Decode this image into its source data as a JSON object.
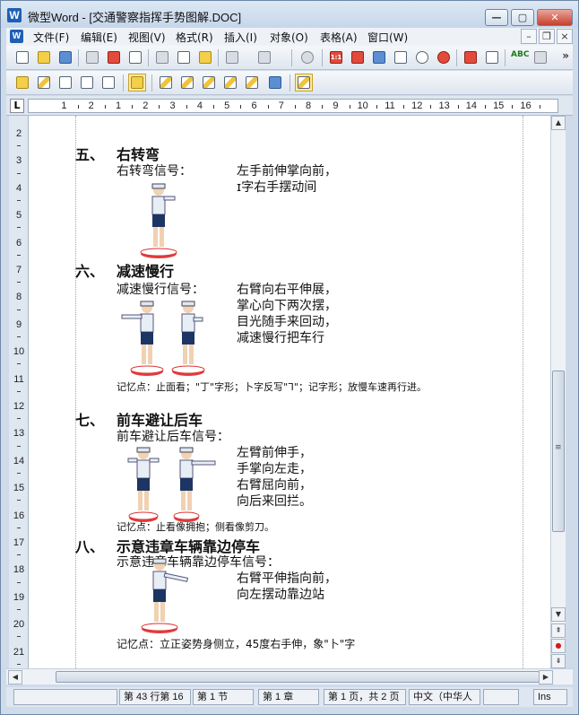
{
  "window": {
    "app_name": "微型Word",
    "title": "微型Word - [交通警察指挥手势图解.DOC]",
    "btn_minimize": "—",
    "btn_maximize": "▢",
    "btn_close": "✕",
    "doc_minimize": "–",
    "doc_restore": "❐",
    "doc_close": "×"
  },
  "menu": {
    "items": [
      {
        "label": "文件(F)"
      },
      {
        "label": "编辑(E)"
      },
      {
        "label": "视图(V)"
      },
      {
        "label": "格式(R)"
      },
      {
        "label": "插入(I)"
      },
      {
        "label": "对象(O)"
      },
      {
        "label": "表格(A)"
      },
      {
        "label": "窗口(W)"
      }
    ]
  },
  "toolbar": {
    "overflow": "»",
    "spell_label": "ABC",
    "table_label": "1:1"
  },
  "ruler": {
    "corner": "L",
    "h_numbers": [
      "1",
      "2",
      "1",
      "2",
      "3",
      "4",
      "5",
      "6",
      "7",
      "8",
      "9",
      "10",
      "11",
      "12",
      "13",
      "14",
      "15",
      "16"
    ],
    "v_numbers": [
      "2",
      "3",
      "4",
      "5",
      "6",
      "7",
      "8",
      "9",
      "10",
      "11",
      "12",
      "13",
      "14",
      "15",
      "16",
      "17",
      "18",
      "19",
      "20",
      "21"
    ]
  },
  "document": {
    "s5": {
      "heading_num": "五、",
      "heading": "右转弯",
      "label": "右转弯信号：",
      "lines": [
        "左手前伸掌向前，",
        "ɪ字右手摆动间"
      ]
    },
    "s6": {
      "heading_num": "六、",
      "heading": "减速慢行",
      "label": "减速慢行信号：",
      "lines": [
        "右臂向右平伸展，",
        "掌心向下两次摆，",
        "目光随手来回动，",
        "减速慢行把车行"
      ],
      "memory": "记忆点：止面看；\"丁\"字形；卜字反写\"ᒣ\"；记字形；放慢车速再行进。"
    },
    "s7": {
      "heading_num": "七、",
      "heading": "前车避让后车",
      "label": "前车避让后车信号：",
      "lines": [
        "左臂前伸手，",
        "手掌向左走，",
        "右臂屈向前，",
        "向后来回拦。"
      ],
      "memory": "记忆点：止看像拥抱；侧看像剪刀。"
    },
    "s8": {
      "heading_num": "八、",
      "heading": "示意违章车辆靠边停车",
      "label": "示意违章车辆靠边停车信号：",
      "lines": [
        "右臂平伸指向前，",
        "向左摆动靠边站"
      ],
      "memory": "记忆点：立正姿势身侧立，45度右手伸，象\"卜\"字"
    }
  },
  "scrollbar": {
    "up": "▲",
    "down": "▼",
    "left": "◀",
    "right": "▶",
    "prev_page": "⇞",
    "select_browse": "●",
    "next_page": "⇟",
    "grip": "≡"
  },
  "status": {
    "position": "第 43 行第 16",
    "section": "第 1 节",
    "chapter": "第 1 章",
    "page": "第 1 页，共 2 页",
    "language": "中文（中华人",
    "blank": "",
    "mode": "Ins"
  }
}
